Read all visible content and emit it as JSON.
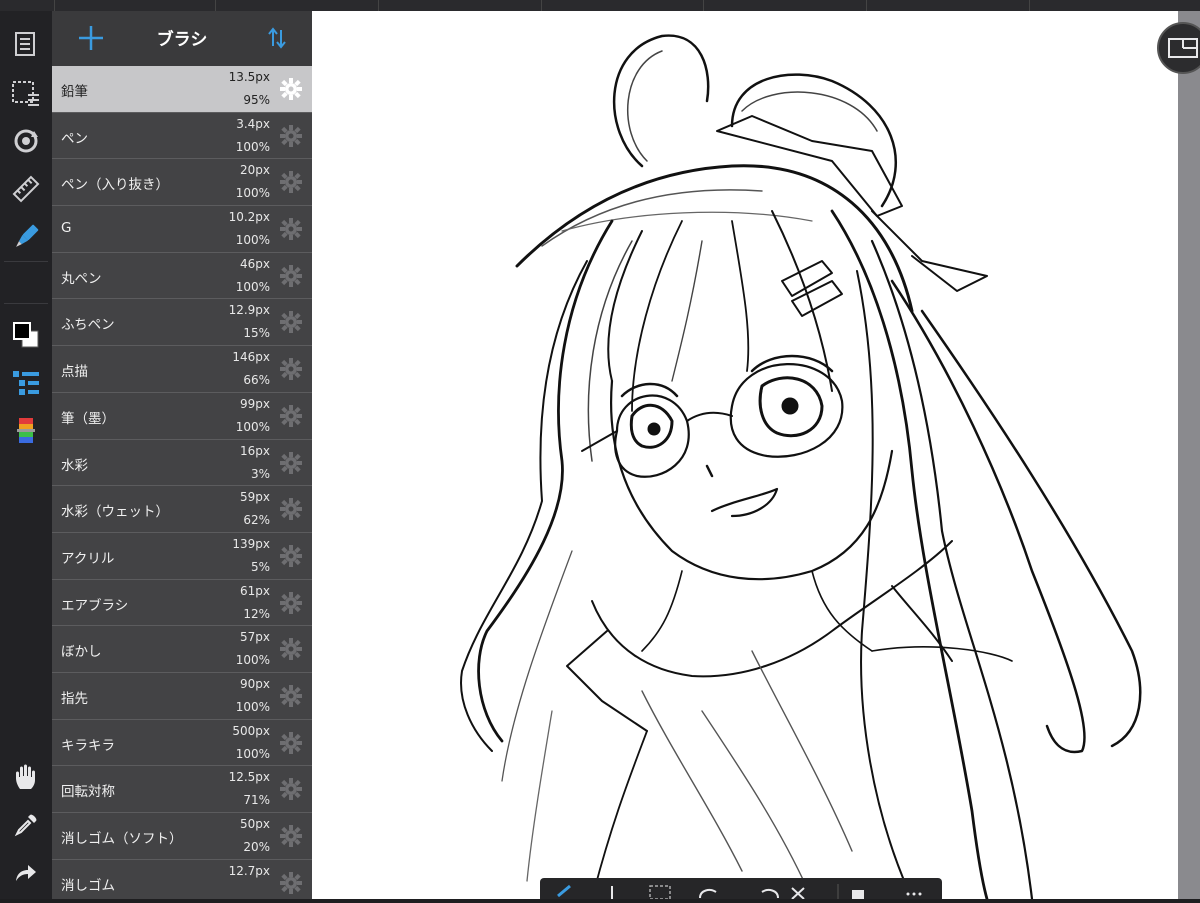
{
  "panel": {
    "title": "ブラシ",
    "add_icon": "plus-icon",
    "sort_icon": "sort-arrows-icon"
  },
  "brushes": [
    {
      "name": "鉛筆",
      "size": "13.5px",
      "opacity": "95%",
      "selected": true
    },
    {
      "name": "ペン",
      "size": "3.4px",
      "opacity": "100%"
    },
    {
      "name": "ペン（入り抜き）",
      "size": "20px",
      "opacity": "100%"
    },
    {
      "name": "G",
      "size": "10.2px",
      "opacity": "100%"
    },
    {
      "name": "丸ペン",
      "size": "46px",
      "opacity": "100%"
    },
    {
      "name": "ふちペン",
      "size": "12.9px",
      "opacity": "15%"
    },
    {
      "name": "点描",
      "size": "146px",
      "opacity": "66%"
    },
    {
      "name": "筆（墨）",
      "size": "99px",
      "opacity": "100%"
    },
    {
      "name": "水彩",
      "size": "16px",
      "opacity": "3%"
    },
    {
      "name": "水彩（ウェット）",
      "size": "59px",
      "opacity": "62%"
    },
    {
      "name": "アクリル",
      "size": "139px",
      "opacity": "5%"
    },
    {
      "name": "エアブラシ",
      "size": "61px",
      "opacity": "12%"
    },
    {
      "name": "ぼかし",
      "size": "57px",
      "opacity": "100%"
    },
    {
      "name": "指先",
      "size": "90px",
      "opacity": "100%"
    },
    {
      "name": "キラキラ",
      "size": "500px",
      "opacity": "100%"
    },
    {
      "name": "回転対称",
      "size": "12.5px",
      "opacity": "71%"
    },
    {
      "name": "消しゴム（ソフト）",
      "size": "50px",
      "opacity": "20%"
    },
    {
      "name": "消しゴム",
      "size": "12.7px",
      "opacity": ""
    }
  ],
  "toolbar": {
    "tools": [
      "pages-icon",
      "selection-icon",
      "transform-icon",
      "ruler-icon",
      "brush-icon",
      "color-icon",
      "layers-icon",
      "gradient-icon",
      "hand-icon",
      "eyedropper-icon",
      "redo-icon"
    ]
  },
  "colors": {
    "accent": "#3a9be0",
    "panel_bg": "#434345",
    "selected_row": "#c7c7c9",
    "toolbar_bg": "#222225"
  }
}
